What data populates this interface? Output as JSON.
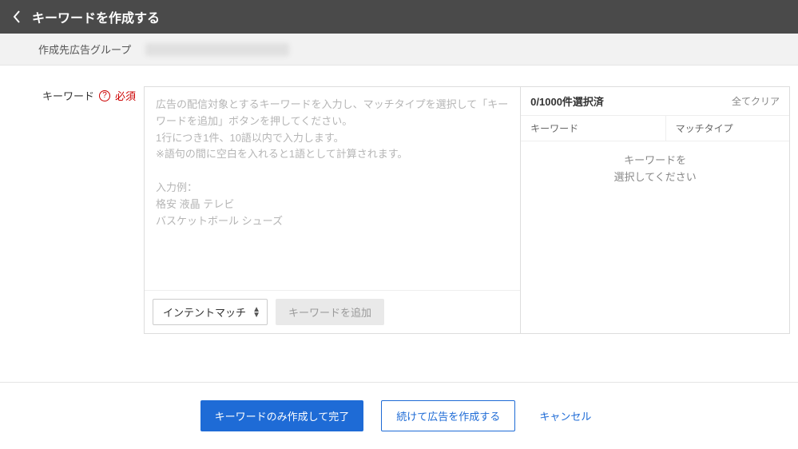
{
  "header": {
    "title": "キーワードを作成する"
  },
  "subheader": {
    "label": "作成先広告グループ"
  },
  "form": {
    "keyword_label": "キーワード",
    "required_label": "必須",
    "textarea_placeholder": "広告の配信対象とするキーワードを入力し、マッチタイプを選択して「キーワードを追加」ボタンを押してください。\n1行につき1件、10語以内で入力します。\n※語句の間に空白を入れると1語として計算されます。\n\n入力例：\n格安 液晶 テレビ\nバスケットボール シューズ",
    "match_type_selected": "インテントマッチ",
    "add_button": "キーワードを追加"
  },
  "selected": {
    "count_text": "0/1000件選択済",
    "clear_all": "全てクリア",
    "col_keyword": "キーワード",
    "col_matchtype": "マッチタイプ",
    "empty_line1": "キーワードを",
    "empty_line2": "選択してください"
  },
  "footer": {
    "primary": "キーワードのみ作成して完了",
    "secondary": "続けて広告を作成する",
    "cancel": "キャンセル"
  }
}
